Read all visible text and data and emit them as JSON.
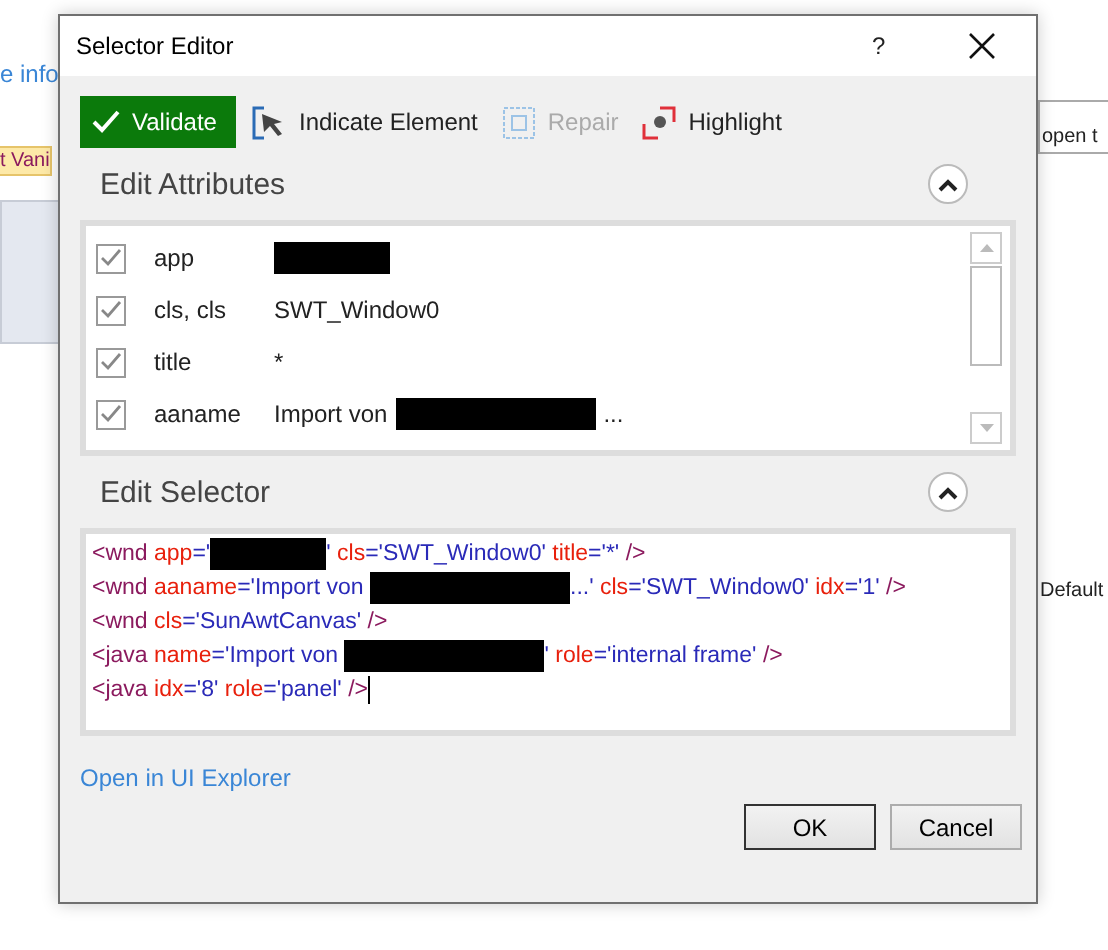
{
  "background": {
    "texts": [
      {
        "text": "e info",
        "kind": "link"
      },
      {
        "text": "t Vani",
        "kind": "tag"
      },
      {
        "text": "open t",
        "kind": "plain"
      },
      {
        "text": "Default",
        "kind": "plain"
      }
    ]
  },
  "dialog": {
    "title": "Selector Editor",
    "help": "?",
    "toolbar": [
      {
        "label": "Validate",
        "kind": "primary",
        "disabled": false
      },
      {
        "label": "Indicate Element",
        "kind": "indicate",
        "disabled": false
      },
      {
        "label": "Repair",
        "kind": "repair",
        "disabled": true
      },
      {
        "label": "Highlight",
        "kind": "highlight",
        "disabled": false
      }
    ],
    "attributes_section": {
      "title": "Edit Attributes",
      "expanded": true,
      "rows": [
        {
          "name": "app",
          "checked": true,
          "value": [
            {
              "kind": "redacted"
            }
          ]
        },
        {
          "name": "cls, cls",
          "checked": true,
          "value": [
            {
              "kind": "text",
              "text": "SWT_Window0"
            }
          ]
        },
        {
          "name": "title",
          "checked": true,
          "value": [
            {
              "kind": "text",
              "text": "*"
            }
          ]
        },
        {
          "name": "aaname",
          "checked": true,
          "value": [
            {
              "kind": "text",
              "text": "Import von"
            },
            {
              "kind": "redacted"
            },
            {
              "kind": "text",
              "text": "..."
            }
          ]
        }
      ]
    },
    "selector_section": {
      "title": "Edit Selector",
      "expanded": true,
      "lines": [
        [
          {
            "kind": "tag",
            "text": "<wnd "
          },
          {
            "kind": "attr",
            "text": "app"
          },
          {
            "kind": "value",
            "text": "='"
          },
          {
            "kind": "redacted"
          },
          {
            "kind": "value",
            "text": "' "
          },
          {
            "kind": "attr",
            "text": "cls"
          },
          {
            "kind": "value",
            "text": "='SWT_Window0' "
          },
          {
            "kind": "attr",
            "text": "title"
          },
          {
            "kind": "value",
            "text": "='*' "
          },
          {
            "kind": "tag",
            "text": "/>"
          }
        ],
        [
          {
            "kind": "tag",
            "text": "<wnd "
          },
          {
            "kind": "attr",
            "text": "aaname"
          },
          {
            "kind": "value",
            "text": "='Import von "
          },
          {
            "kind": "redacted"
          },
          {
            "kind": "value",
            "text": "...' "
          },
          {
            "kind": "attr",
            "text": "cls"
          },
          {
            "kind": "value",
            "text": "='SWT_Window0' "
          },
          {
            "kind": "attr",
            "text": "idx"
          },
          {
            "kind": "value",
            "text": "='1' "
          },
          {
            "kind": "tag",
            "text": "/>"
          }
        ],
        [
          {
            "kind": "tag",
            "text": "<wnd "
          },
          {
            "kind": "attr",
            "text": "cls"
          },
          {
            "kind": "value",
            "text": "='SunAwtCanvas' "
          },
          {
            "kind": "tag",
            "text": "/>"
          }
        ],
        [
          {
            "kind": "tag",
            "text": "<java "
          },
          {
            "kind": "attr",
            "text": "name"
          },
          {
            "kind": "value",
            "text": "='Import von "
          },
          {
            "kind": "redacted"
          },
          {
            "kind": "value",
            "text": "' "
          },
          {
            "kind": "attr",
            "text": "role"
          },
          {
            "kind": "value",
            "text": "='internal frame' "
          },
          {
            "kind": "tag",
            "text": "/>"
          }
        ],
        [
          {
            "kind": "tag",
            "text": "<java "
          },
          {
            "kind": "attr",
            "text": "idx"
          },
          {
            "kind": "value",
            "text": "='8' "
          },
          {
            "kind": "attr",
            "text": "role"
          },
          {
            "kind": "value",
            "text": "='panel' "
          },
          {
            "kind": "tag",
            "text": "/>"
          }
        ]
      ]
    },
    "link": "Open in UI Explorer",
    "buttons": [
      {
        "label": "OK",
        "kind": "default"
      },
      {
        "label": "Cancel",
        "kind": "normal"
      }
    ]
  }
}
